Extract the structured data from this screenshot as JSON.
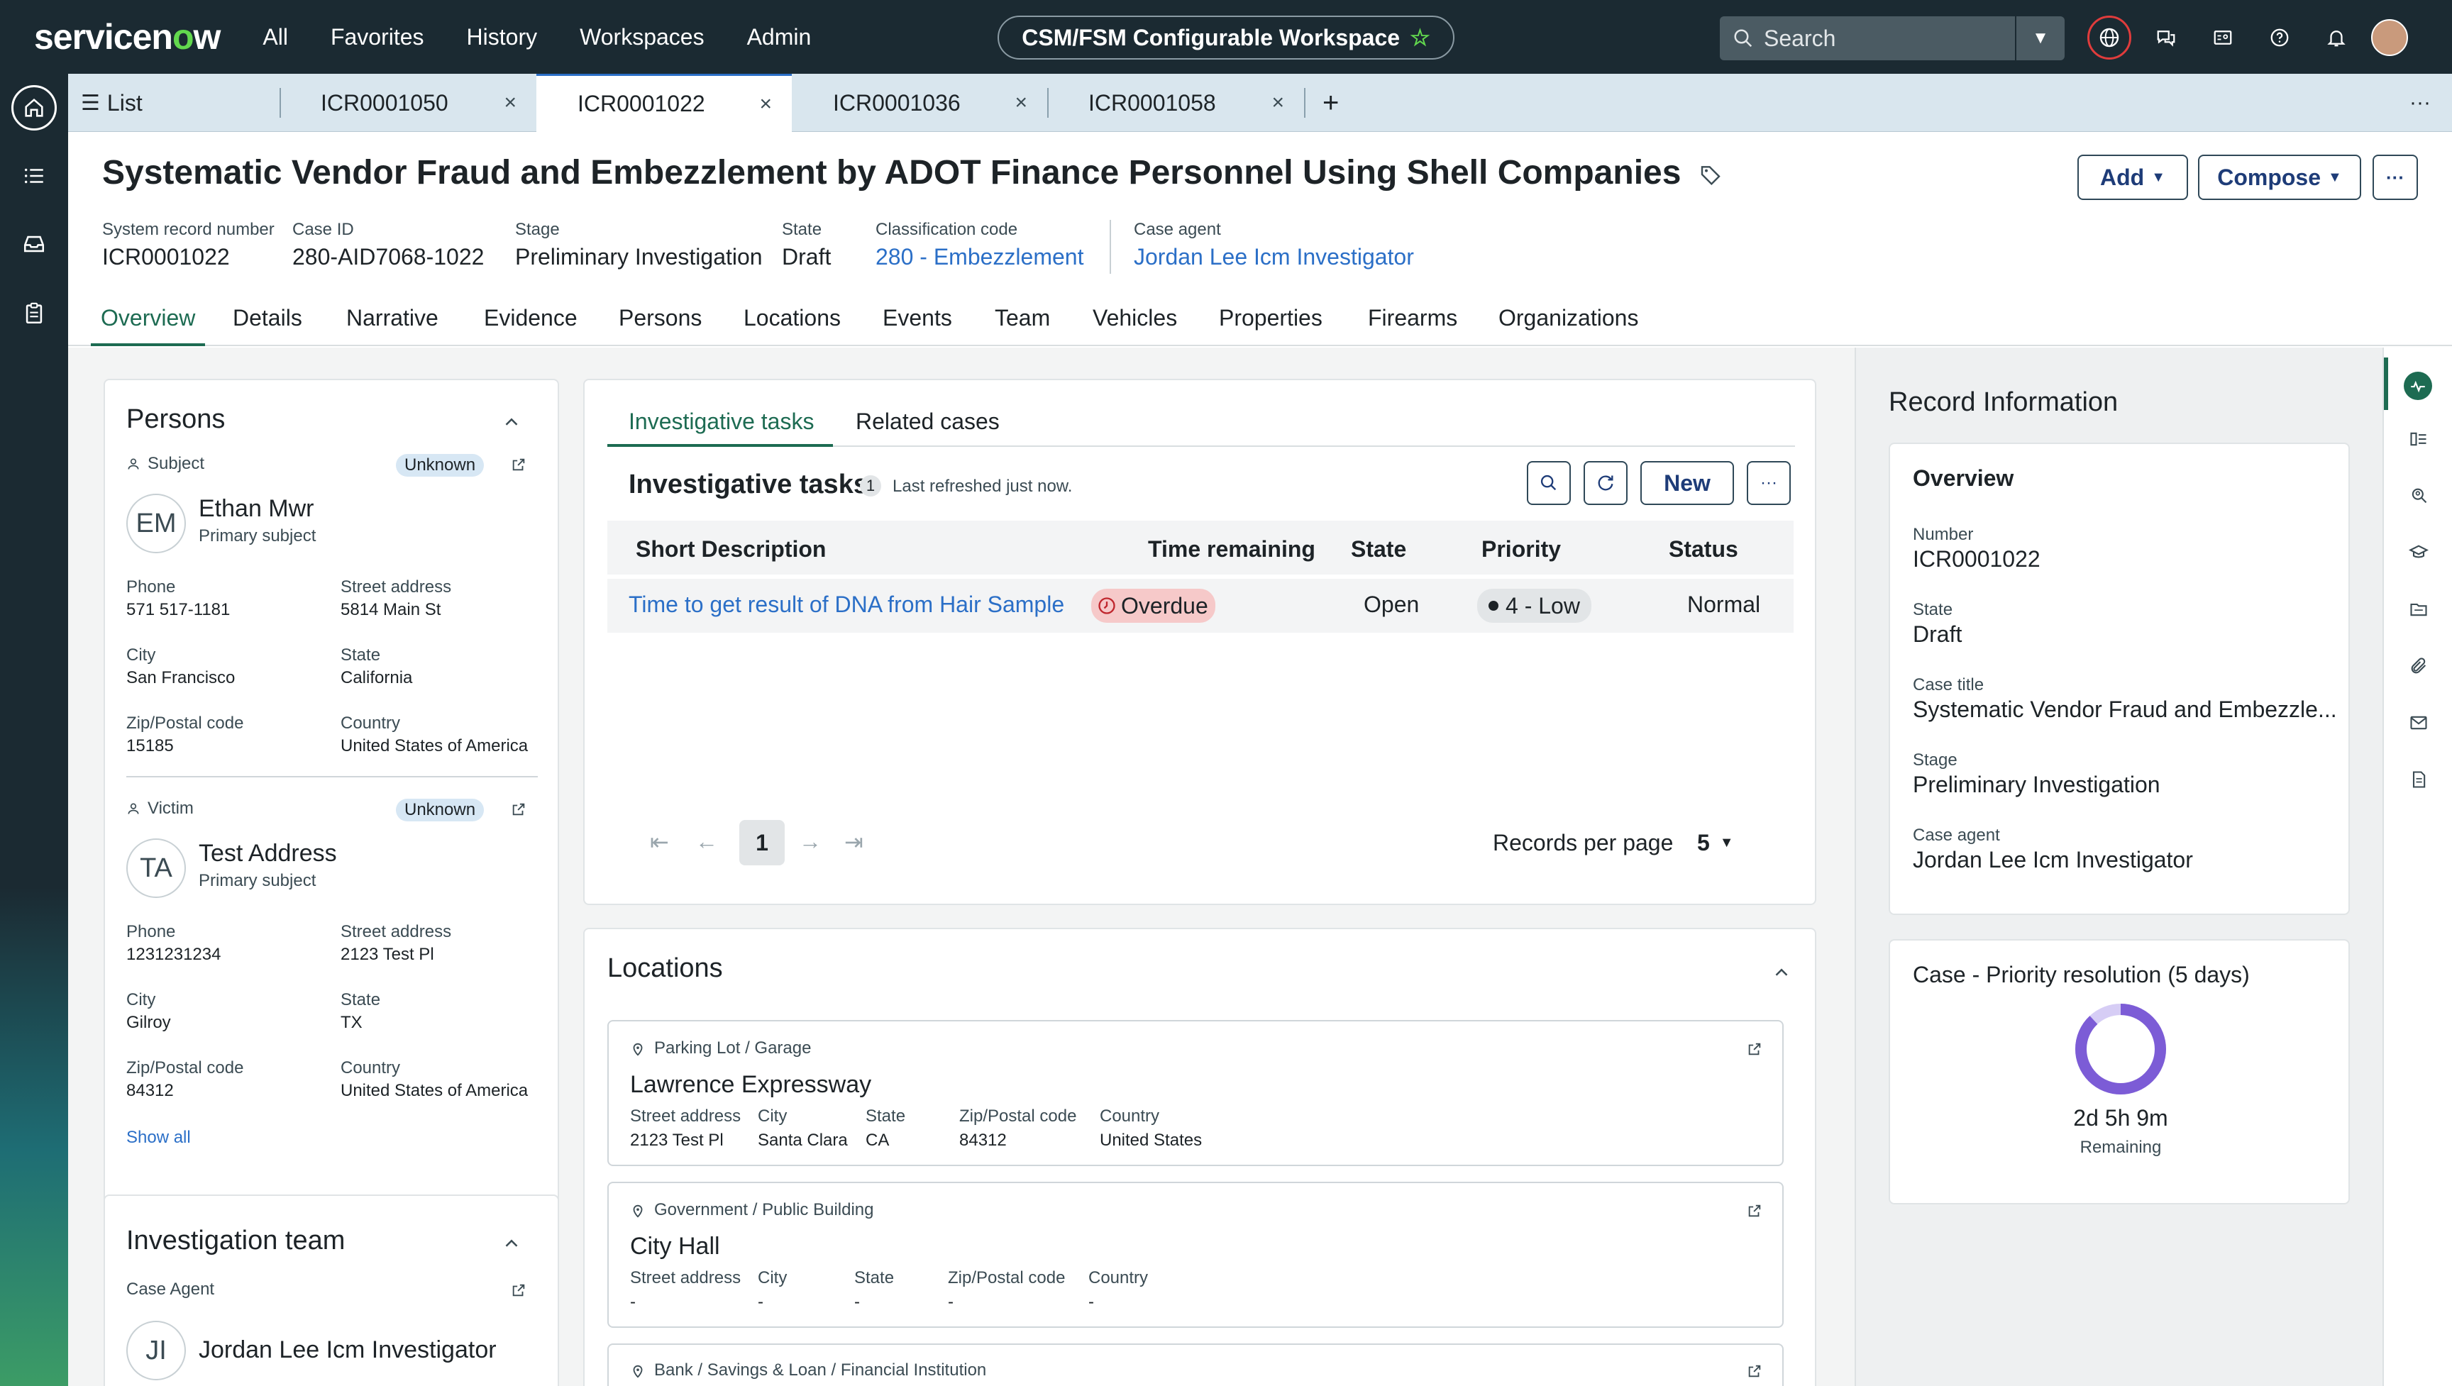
{
  "topnav": {
    "logo": "servicenow",
    "links": [
      "All",
      "Favorites",
      "History",
      "Workspaces",
      "Admin"
    ],
    "workspace": "CSM/FSM Configurable Workspace",
    "search_placeholder": "Search"
  },
  "tabs": {
    "list": "List",
    "items": [
      "ICR0001050",
      "ICR0001022",
      "ICR0001036",
      "ICR0001058"
    ]
  },
  "record": {
    "title": "Systematic Vendor Fraud and Embezzlement by ADOT Finance Personnel Using Shell Companies",
    "add_label": "Add",
    "compose_label": "Compose",
    "meta": [
      {
        "label": "System record number",
        "value": "ICR0001022"
      },
      {
        "label": "Case ID",
        "value": "280-AID7068-1022"
      },
      {
        "label": "Stage",
        "value": "Preliminary Investigation"
      },
      {
        "label": "State",
        "value": "Draft"
      },
      {
        "label": "Classification code",
        "value": "280 - Embezzlement"
      },
      {
        "label": "Case agent",
        "value": "Jordan Lee Icm Investigator"
      }
    ]
  },
  "subtabs": [
    "Overview",
    "Details",
    "Narrative",
    "Evidence",
    "Persons",
    "Locations",
    "Events",
    "Team",
    "Vehicles",
    "Properties",
    "Firearms",
    "Organizations"
  ],
  "persons": {
    "title": "Persons",
    "show_all": "Show all",
    "people": [
      {
        "role": "Subject",
        "badge": "Unknown",
        "initials": "EM",
        "name": "Ethan Mwr",
        "type": "Primary subject",
        "fields": [
          {
            "label": "Phone",
            "value": "571 517-1181"
          },
          {
            "label": "Street address",
            "value": "5814 Main St"
          },
          {
            "label": "City",
            "value": "San Francisco"
          },
          {
            "label": "State",
            "value": "California"
          },
          {
            "label": "Zip/Postal code",
            "value": "15185"
          },
          {
            "label": "Country",
            "value": "United States of America"
          }
        ]
      },
      {
        "role": "Victim",
        "badge": "Unknown",
        "initials": "TA",
        "name": "Test Address",
        "type": "Primary subject",
        "fields": [
          {
            "label": "Phone",
            "value": "1231231234"
          },
          {
            "label": "Street address",
            "value": "2123 Test Pl"
          },
          {
            "label": "City",
            "value": "Gilroy"
          },
          {
            "label": "State",
            "value": "TX"
          },
          {
            "label": "Zip/Postal code",
            "value": "84312"
          },
          {
            "label": "Country",
            "value": "United States of America"
          }
        ]
      }
    ]
  },
  "team": {
    "title": "Investigation team",
    "role": "Case Agent",
    "initials": "JI",
    "name": "Jordan Lee Icm Investigator"
  },
  "tasks": {
    "tabs": [
      "Investigative tasks",
      "Related cases"
    ],
    "title": "Investigative tasks",
    "count": "1",
    "refreshed": "Last refreshed just now.",
    "new_label": "New",
    "columns": [
      "Short Description",
      "Time remaining",
      "State",
      "Priority",
      "Status"
    ],
    "rows": [
      {
        "description": "Time to get result of DNA from Hair Sample",
        "time": "Overdue",
        "state": "Open",
        "priority": "4 - Low",
        "status": "Normal"
      }
    ],
    "page": "1",
    "per_page_label": "Records per page",
    "per_page": "5"
  },
  "locations": {
    "title": "Locations",
    "cols": [
      "Street address",
      "City",
      "State",
      "Zip/Postal code",
      "Country"
    ],
    "items": [
      {
        "category": "Parking Lot / Garage",
        "name": "Lawrence Expressway",
        "values": [
          "2123 Test Pl",
          "Santa Clara",
          "CA",
          "84312",
          "United States"
        ]
      },
      {
        "category": "Government / Public Building",
        "name": "City Hall",
        "values": [
          "-",
          "-",
          "-",
          "-",
          "-"
        ]
      },
      {
        "category": "Bank / Savings & Loan / Financial Institution"
      }
    ]
  },
  "record_info": {
    "title": "Record Information",
    "overview_title": "Overview",
    "fields": [
      {
        "label": "Number",
        "value": "ICR0001022"
      },
      {
        "label": "State",
        "value": "Draft"
      },
      {
        "label": "Case title",
        "value": "Systematic Vendor Fraud and Embezzle..."
      },
      {
        "label": "Stage",
        "value": "Preliminary Investigation"
      },
      {
        "label": "Case agent",
        "value": "Jordan Lee Icm Investigator"
      }
    ],
    "sla_title": "Case - Priority resolution (5 days)",
    "sla_time": "2d 5h 9m",
    "sla_sub": "Remaining",
    "sla_elapsed_fraction": 0.12
  },
  "colors": {
    "accent_green": "#1d6b52",
    "link_blue": "#2b6fc7",
    "nav_bg": "#1b2a32",
    "sla_ring": "#7c5cd6"
  }
}
